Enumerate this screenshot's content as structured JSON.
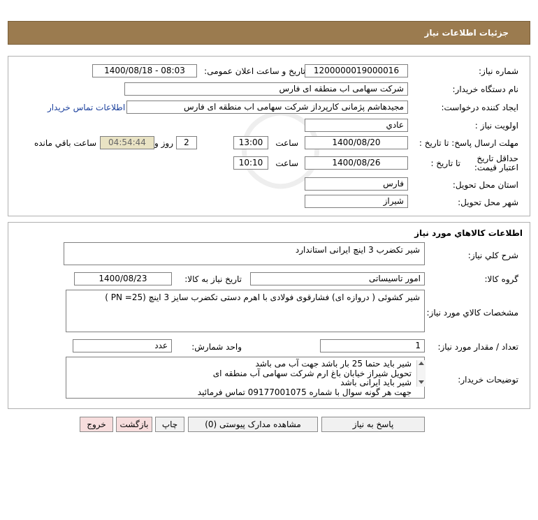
{
  "header": {
    "title": "جزئیات اطلاعات نیاز"
  },
  "info": {
    "need_number_label": "شماره نیاز:",
    "need_number": "1200000019000016",
    "announce_label": "تاریخ و ساعت اعلان عمومی:",
    "announce_value": "1400/08/18 - 08:03",
    "buyer_org_label": "نام دستگاه خریدار:",
    "buyer_org": "شرکت سهامی اب منطقه ای فارس",
    "creator_label": "ایجاد کننده درخواست:",
    "creator": "مجیدهاشم پژمانی کارپرداز شرکت سهامی اب منطقه ای فارس",
    "contact_link": "اطلاعات تماس خریدار",
    "priority_label": "اولویت نیاز :",
    "priority": "عادي",
    "deadline_label": "مهلت ارسال پاسخ: تا تاریخ :",
    "deadline_date": "1400/08/20",
    "time_label": "ساعت",
    "deadline_time": "13:00",
    "days_value": "2",
    "days_label": "روز و",
    "remaining_time": "04:54:44",
    "remaining_label": "ساعت باقي مانده",
    "validity_label": "حداقل تاریخ اعتبار قیمت:",
    "validity_to_label": "تا تاریخ :",
    "validity_date": "1400/08/26",
    "validity_time_label": "ساعت",
    "validity_time": "10:10",
    "province_label": "استان محل تحویل:",
    "province": "فارس",
    "city_label": "شهر محل تحویل:",
    "city": "شیراز"
  },
  "goods": {
    "section_title": "اطلاعات کالاهاي مورد نیاز",
    "summary_label": "شرح کلي نیاز:",
    "summary": "شیر تکضرب 3 اینچ ایرانی استاندارد",
    "group_label": "گروه کالا:",
    "group": "امور تاسیساتی",
    "need_date_label": "تاریخ نیاز به کالا:",
    "need_date": "1400/08/23",
    "spec_label": "مشخصات کالاي مورد نیاز:",
    "spec": "شیر کشوئی ( دروازه ای) فشارقوی فولادی با اهرم دستی تکضرب سایز 3 اینچ  (25= PN )",
    "qty_label": "تعداد / مقدار مورد نیاز:",
    "qty": "1",
    "unit_label": "واحد شمارش:",
    "unit": "عدد",
    "buyer_notes_label": "توضیحات خریدار:",
    "notes": [
      "شیر باید حتما 25 بار باشد  جهت آب می باشد",
      "تحویل شیراز خیابان باغ ارم شرکت سهامی آب منطقه ای",
      "شیر باید ایرانی باشد",
      "جهت هر گونه سوال با شماره 09177001075 تماس فرمائید"
    ]
  },
  "buttons": {
    "reply": "پاسخ به نیاز",
    "attachments": "مشاهده مدارک پیوستی (0)",
    "print": "چاپ",
    "back": "بازگشت",
    "exit": "خروج"
  },
  "watermark": {
    "brand": "ParsNamadData"
  }
}
